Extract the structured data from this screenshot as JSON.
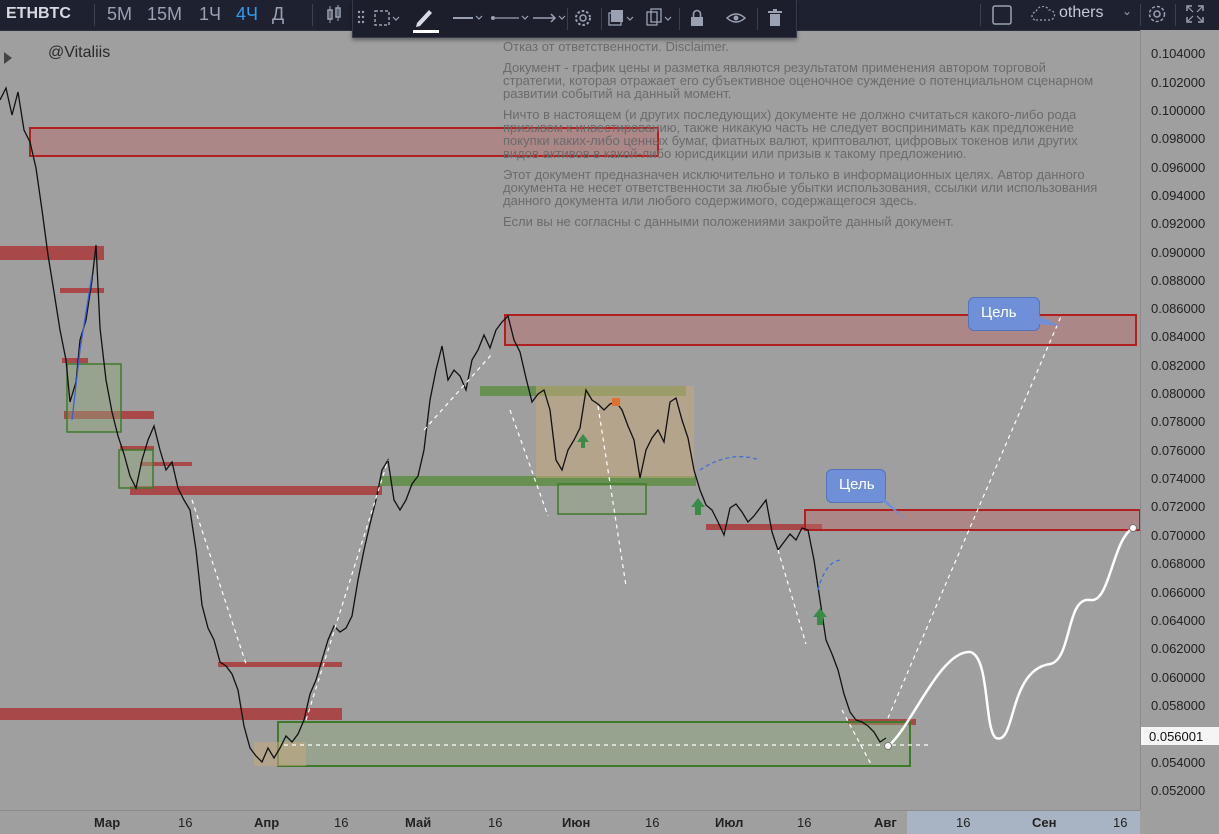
{
  "header": {
    "symbol": "ETHBTC",
    "timeframes": [
      {
        "label": "5M",
        "active": false
      },
      {
        "label": "15M",
        "active": false
      },
      {
        "label": "1Ч",
        "active": false
      },
      {
        "label": "4Ч",
        "active": true
      },
      {
        "label": "Д",
        "active": false
      }
    ],
    "others_label": "others"
  },
  "drawing_toolbar": {
    "tools": [
      "grip-icon",
      "selection-icon",
      "pencil-icon",
      "line-style-icon",
      "line-width-icon",
      "arrow-style-icon",
      "settings-icon",
      "layers-icon",
      "copy-icon",
      "lock-icon",
      "eye-icon",
      "trash-icon"
    ]
  },
  "chart": {
    "author": "@Vitaliis",
    "price_ticks": [
      "0.104000",
      "0.102000",
      "0.100000",
      "0.098000",
      "0.096000",
      "0.094000",
      "0.092000",
      "0.090000",
      "0.088000",
      "0.086000",
      "0.084000",
      "0.082000",
      "0.080000",
      "0.078000",
      "0.076000",
      "0.074000",
      "0.072000",
      "0.070000",
      "0.068000",
      "0.066000",
      "0.064000",
      "0.062000",
      "0.060000",
      "0.058000",
      "0.056000",
      "0.054000",
      "0.052000"
    ],
    "current_price": "0.056001",
    "time_ticks": [
      {
        "label": "Мар",
        "major": true
      },
      {
        "label": "16",
        "major": false
      },
      {
        "label": "Апр",
        "major": true
      },
      {
        "label": "16",
        "major": false
      },
      {
        "label": "Май",
        "major": true
      },
      {
        "label": "16",
        "major": false
      },
      {
        "label": "Июн",
        "major": true
      },
      {
        "label": "16",
        "major": false
      },
      {
        "label": "Июл",
        "major": true
      },
      {
        "label": "16",
        "major": false
      },
      {
        "label": "Авг",
        "major": true
      },
      {
        "label": "16",
        "major": false
      },
      {
        "label": "Сен",
        "major": true
      },
      {
        "label": "16",
        "major": false
      }
    ],
    "target_label_1": "Цель",
    "target_label_2": "Цель",
    "disclaimer": [
      "Отказ от ответственности. Disclaimer.",
      "Документ - график цены и разметка являются результатом применения автором торговой стратегии, которая отражает его субъективное оценочное суждение о потенциальном сценарном развитии событий на данный момент.",
      "Ничто в настоящем (и других последующих) документе не должно считаться какого-либо рода призывом к инвестированию, также никакую часть не следует воспринимать как предложение покупки каких-либо ценных бумаг, фиатных валют, криптовалют, цифровых токенов или других видов активов в какой-либо юрисдикции или призыв к такому предложению.",
      "Этот документ предназначен исключительно и только в информационных целях. Автор данного документа не несет ответственности за любые убытки использования, ссылки или использования данного документа или любого содержимого, содержащегося здесь.",
      "Если вы не согласны с данными положениями закройте данный документ."
    ]
  },
  "colors": {
    "background": "#a09fa0",
    "toolbar": "#1e2230",
    "active_timeframe": "#2f9bf0",
    "resistance_zone": "#b04040",
    "support_zone": "#5a8a3a",
    "callout": "#6f8fd8"
  }
}
